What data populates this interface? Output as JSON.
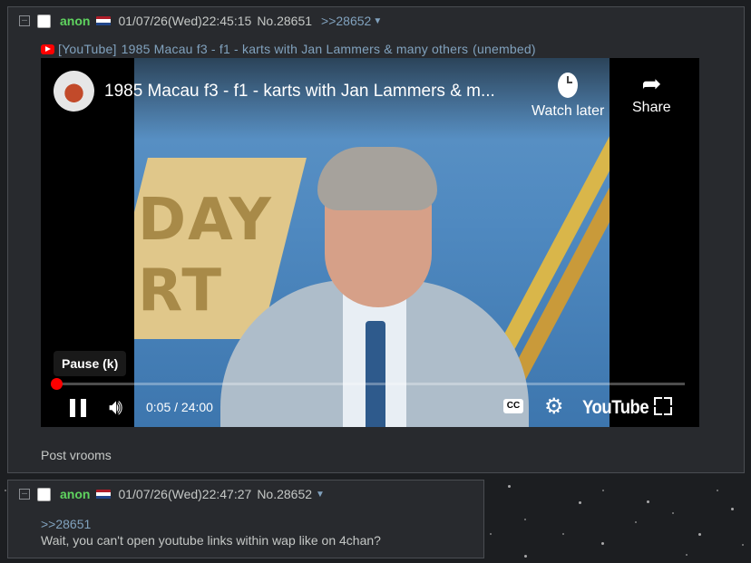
{
  "posts": [
    {
      "toggle": "–",
      "name": "anon",
      "date": "01/07/26(Wed)22:45:15",
      "number": "No.28651",
      "backlink": ">>28652",
      "embed": {
        "site": "[YouTube]",
        "title": "1985 Macau f3 - f1 - karts with Jan Lammers & many others",
        "suffix": "(unembed)"
      },
      "video": {
        "title": "1985 Macau f3 - f1 - karts with Jan Lammers & m...",
        "watch_later": "Watch later",
        "share": "Share",
        "tooltip": "Pause (k)",
        "time": "0:05 / 24:00",
        "progress": 0.0035,
        "cc": "CC",
        "logo": "YouTube",
        "scene_text": "DAY\nRT"
      },
      "comment": "Post vrooms"
    },
    {
      "toggle": "–",
      "name": "anon",
      "date": "01/07/26(Wed)22:47:27",
      "number": "No.28652",
      "quote": ">>28651",
      "comment": "Wait, you can't open youtube links within wap like on 4chan?"
    }
  ],
  "colors": {
    "name": "#5fd35f",
    "link": "#81a2be",
    "post_bg": "#282a2e",
    "page_bg": "#1c1e21",
    "progress": "#ff0000"
  },
  "icons": [
    "minus-toggle-icon",
    "checkbox",
    "netherlands-flag-icon",
    "youtube-icon",
    "clock-icon",
    "share-icon",
    "pause-icon",
    "volume-icon",
    "cc-icon",
    "gear-icon",
    "fullscreen-icon"
  ]
}
